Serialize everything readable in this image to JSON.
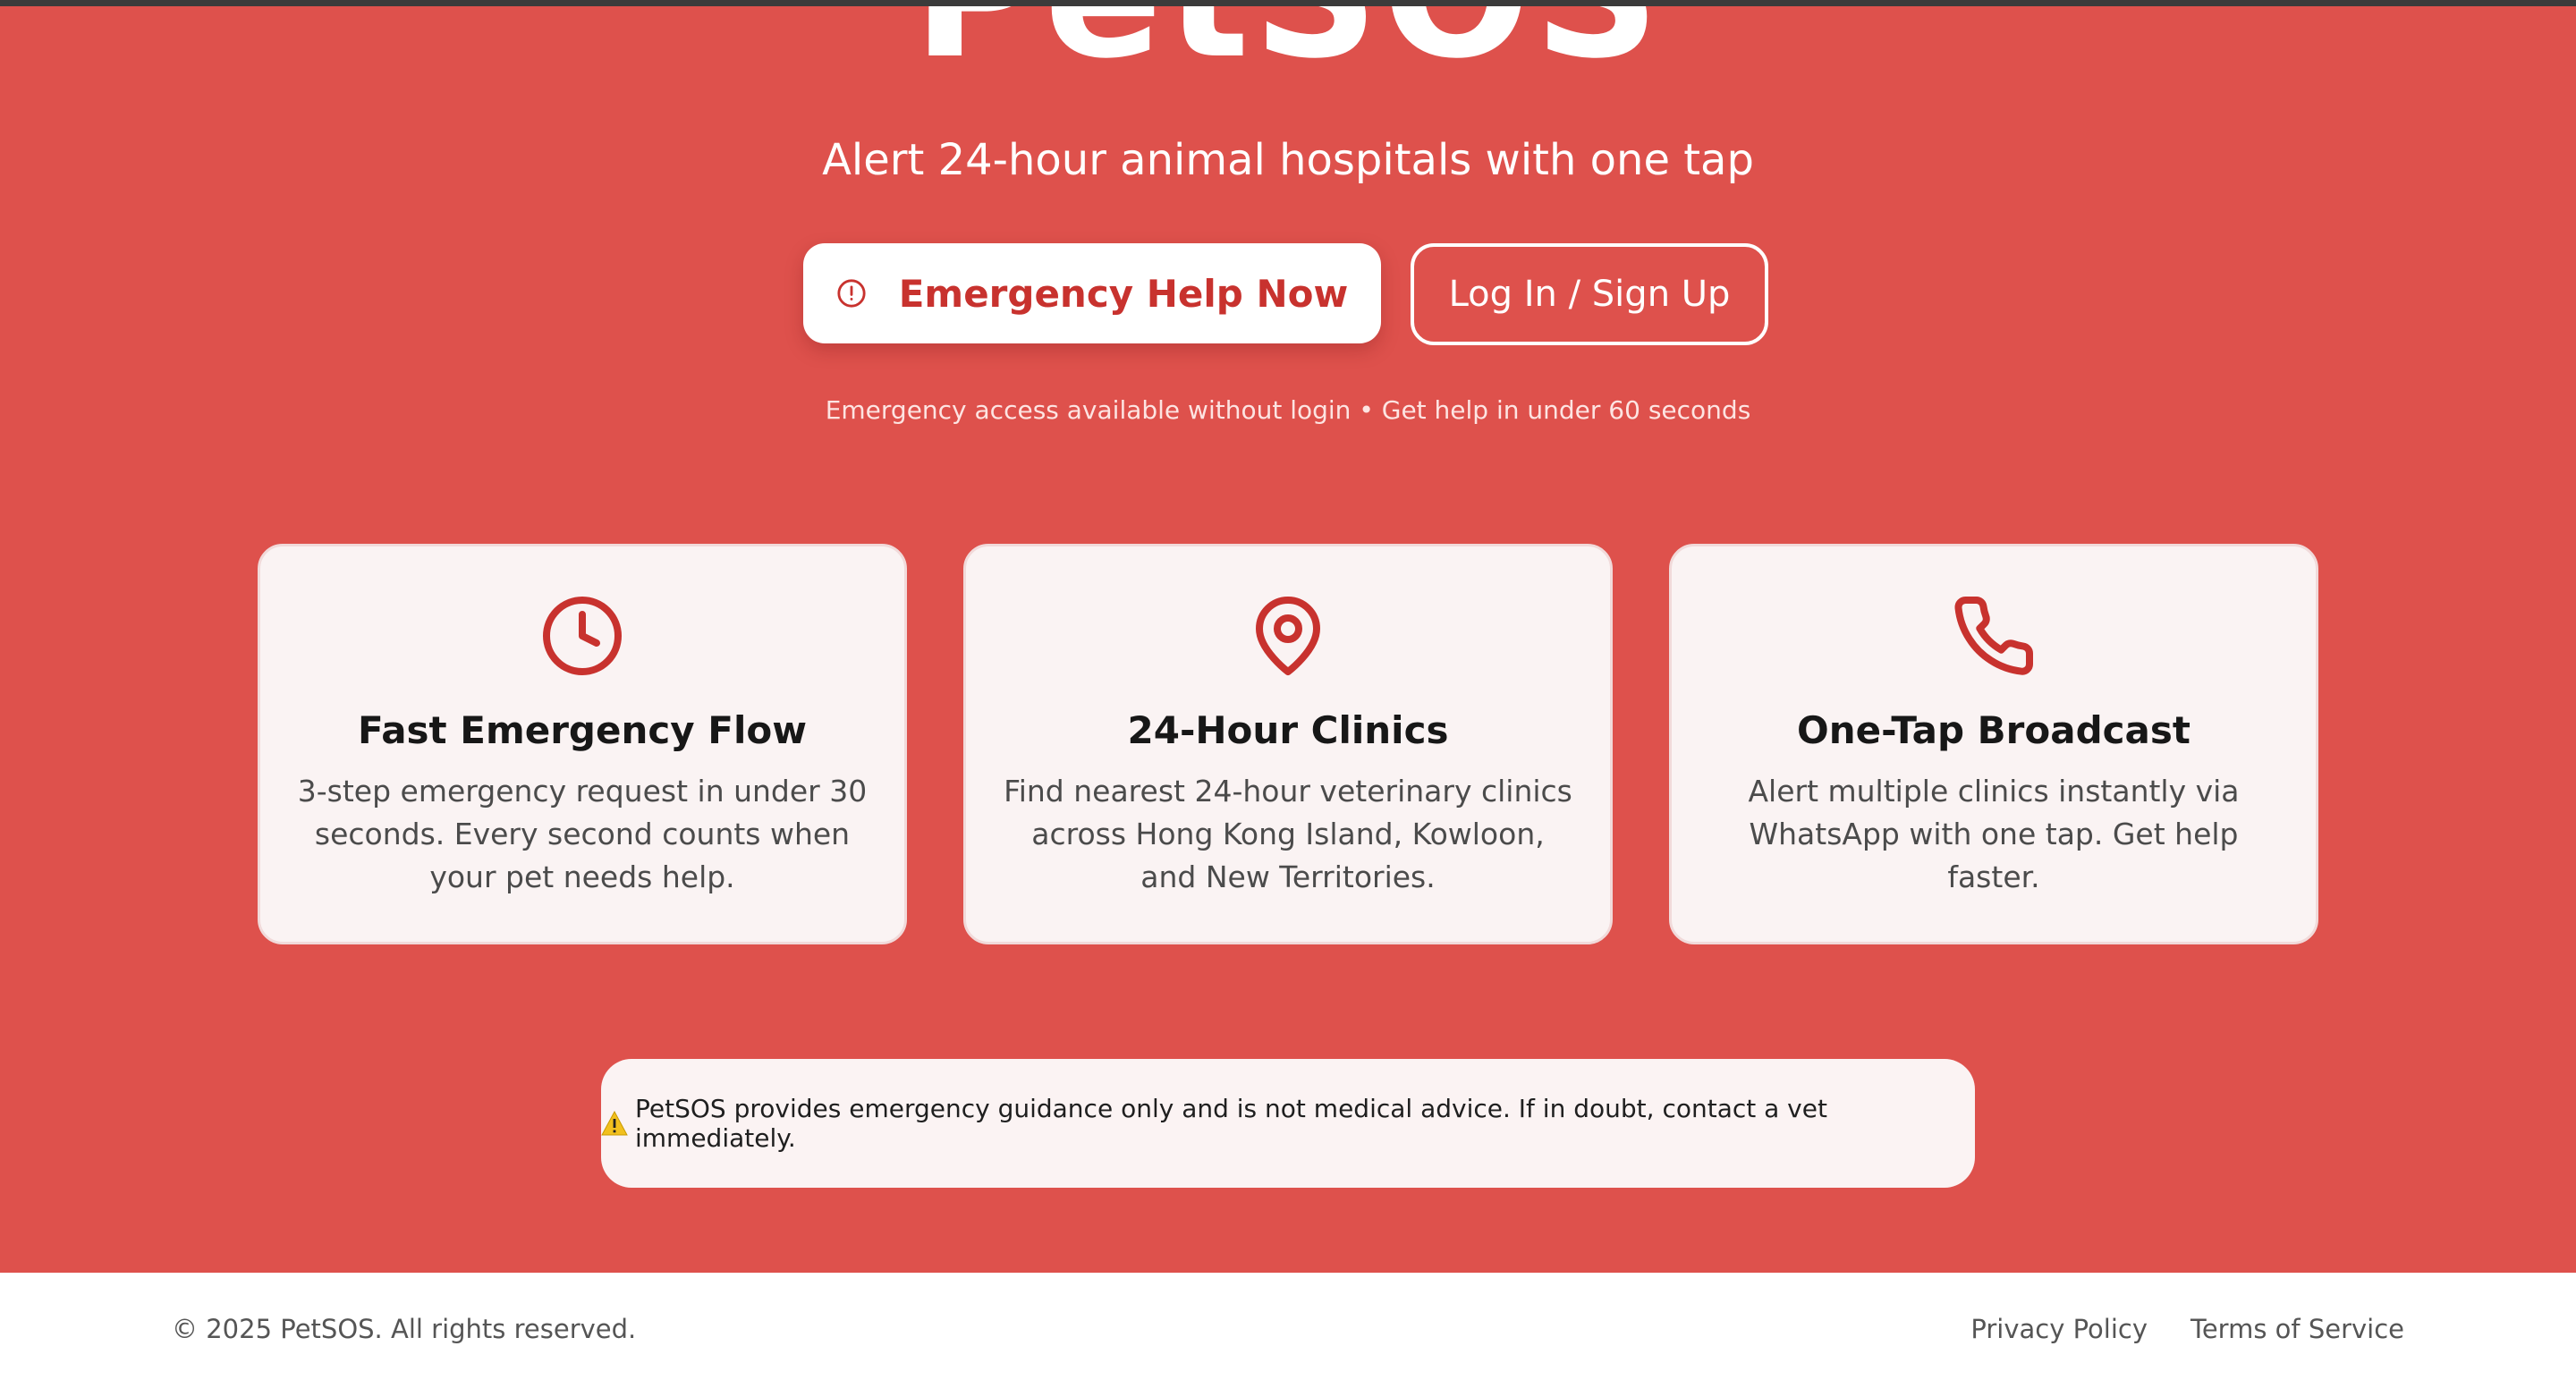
{
  "brand": {
    "name": "PetSOS"
  },
  "hero": {
    "tagline": "Alert 24-hour animal hospitals with one tap",
    "primary_button": {
      "label": "Emergency Help Now",
      "icon": "alert-circle-icon"
    },
    "secondary_button": {
      "label": "Log In / Sign Up"
    },
    "note": "Emergency access available without login • Get help in under 60 seconds"
  },
  "features": [
    {
      "icon": "clock-icon",
      "title": "Fast Emergency Flow",
      "description": "3-step emergency request in under 30 seconds. Every second counts when your pet needs help."
    },
    {
      "icon": "map-pin-icon",
      "title": "24-Hour Clinics",
      "description": "Find nearest 24-hour veterinary clinics across Hong Kong Island, Kowloon, and New Territories."
    },
    {
      "icon": "phone-icon",
      "title": "One-Tap Broadcast",
      "description": "Alert multiple clinics instantly via WhatsApp with one tap. Get help faster."
    }
  ],
  "disclaimer": {
    "icon": "warning-icon",
    "text": "PetSOS provides emergency guidance only and is not medical advice. If in doubt, contact a vet immediately."
  },
  "footer": {
    "copyright": "© 2025 PetSOS. All rights reserved.",
    "links": [
      "Privacy Policy",
      "Terms of Service"
    ]
  },
  "colors": {
    "hero_background": "#de514c",
    "accent": "#c8322e",
    "card_background": "#faf3f3",
    "top_bar": "#3b3b3b"
  }
}
